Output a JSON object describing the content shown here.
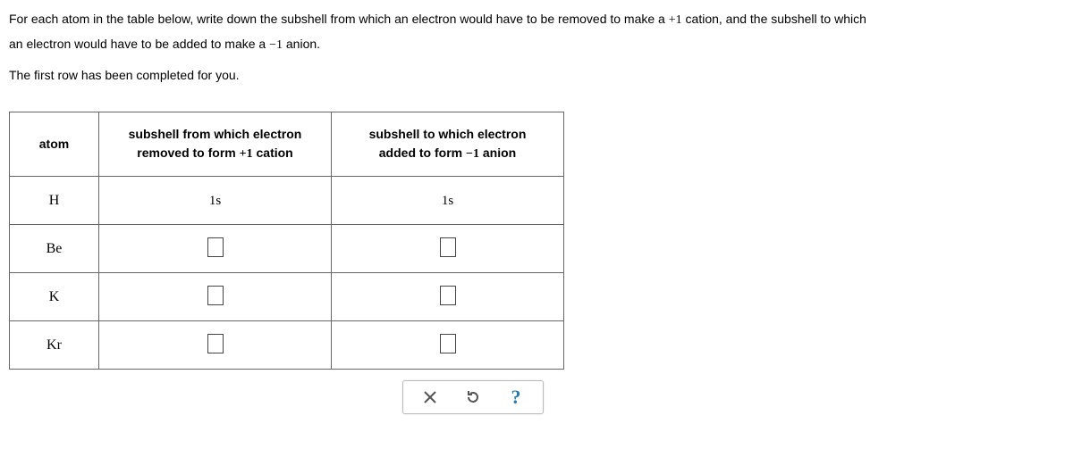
{
  "instructions": {
    "line1_part1": "For each atom in the table below, write down the subshell from which an electron would have to be removed to make a ",
    "line1_math": "+1",
    "line1_part2": " cation, and the subshell to which",
    "line2_part1": "an electron would have to be added to make a ",
    "line2_math": "−1",
    "line2_part2": " anion.",
    "line3": "The first row has been completed for you."
  },
  "table": {
    "headers": {
      "atom": "atom",
      "col2_line1": "subshell from which electron",
      "col2_line2_a": "removed to form ",
      "col2_line2_math": "+1",
      "col2_line2_b": " cation",
      "col3_line1": "subshell to which electron",
      "col3_line2_a": "added to form ",
      "col3_line2_math": "−1",
      "col3_line2_b": " anion"
    },
    "rows": [
      {
        "atom": "H",
        "remove": "1s",
        "add": "1s",
        "filled": true
      },
      {
        "atom": "Be",
        "remove": "",
        "add": "",
        "filled": false
      },
      {
        "atom": "K",
        "remove": "",
        "add": "",
        "filled": false
      },
      {
        "atom": "Kr",
        "remove": "",
        "add": "",
        "filled": false
      }
    ]
  },
  "toolbar": {
    "clear": "clear",
    "reset": "reset",
    "help": "?"
  }
}
